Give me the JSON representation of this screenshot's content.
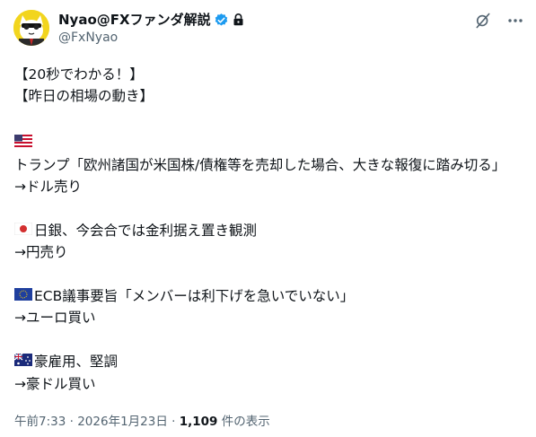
{
  "author": {
    "display_name": "Nyao@FXファンダ解説",
    "handle": "@FxNyao"
  },
  "tweet": {
    "lines": [
      "【20秒でわかる！】",
      "【昨日の相場の動き】",
      "",
      "トランプ「欧州諸国が米国株/債権等を売却した場合、大きな報復に踏み切る」",
      "→ドル売り",
      "",
      "日銀、今会合では金利据え置き観測",
      "→円売り",
      "",
      "ECB議事要旨「メンバーは利下げを急いでいない」",
      "→ユーロ買い",
      "",
      "豪雇用、堅調",
      "→豪ドル買い"
    ]
  },
  "meta": {
    "time": "午前7:33",
    "separator": "·",
    "date": "2026年1月23日",
    "views_count": "1,109",
    "views_label": "件の表示"
  },
  "icons": {
    "verified": "verified-badge-icon",
    "lock": "lock-icon",
    "grok": "grok-icon",
    "more": "more-icon",
    "flags": [
      "us-flag-icon",
      "japan-flag-icon",
      "eu-flag-icon",
      "australia-flag-icon"
    ]
  },
  "colors": {
    "text": "#0f1419",
    "secondary": "#536471",
    "verified": "#1d9bf0"
  }
}
